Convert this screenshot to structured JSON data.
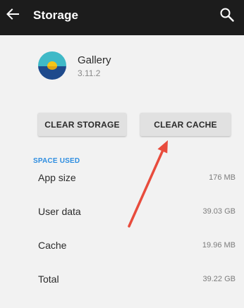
{
  "appbar": {
    "title": "Storage",
    "back_icon": "back-arrow-icon",
    "search_icon": "search-icon"
  },
  "app": {
    "name": "Gallery",
    "version": "3.11.2",
    "icon": "gallery-app-icon"
  },
  "buttons": {
    "clear_storage": "CLEAR STORAGE",
    "clear_cache": "CLEAR CACHE"
  },
  "space_used": {
    "section_label": "SPACE USED",
    "rows": [
      {
        "label": "App size",
        "value": "176 MB"
      },
      {
        "label": "User data",
        "value": "39.03 GB"
      },
      {
        "label": "Cache",
        "value": "19.96 MB"
      },
      {
        "label": "Total",
        "value": "39.22 GB"
      }
    ]
  },
  "colors": {
    "appbar_background": "#1c1c1c",
    "page_background": "#f2f2f2",
    "button_background": "#e1e1e1",
    "section_label": "#2d8de0",
    "annotation_arrow": "#e84c3d",
    "icon_sky": "#3fb9c7",
    "icon_sun": "#f5c518",
    "icon_water": "#1e4a8c"
  }
}
